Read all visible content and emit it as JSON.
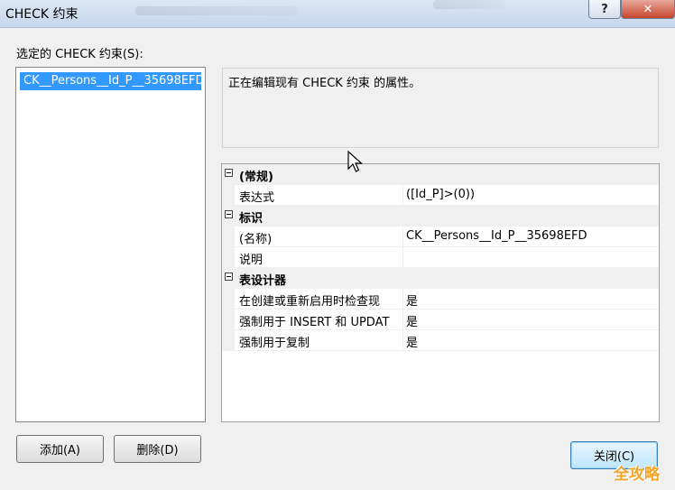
{
  "window": {
    "title": "CHECK 约束",
    "help_label": "?",
    "close_label": "✕"
  },
  "list": {
    "label": "选定的 CHECK 约束(S):",
    "items": [
      "CK__Persons__Id_P__35698EFD"
    ]
  },
  "description": "正在编辑现有 CHECK 约束 的属性。",
  "properties": [
    {
      "category": "(常规)",
      "rows": [
        {
          "name": "表达式",
          "value": "([Id_P]>(0))"
        }
      ]
    },
    {
      "category": "标识",
      "rows": [
        {
          "name": "(名称)",
          "value": "CK__Persons__Id_P__35698EFD"
        },
        {
          "name": "说明",
          "value": ""
        }
      ]
    },
    {
      "category": "表设计器",
      "rows": [
        {
          "name": "在创建或重新启用时检查现",
          "value": "是"
        },
        {
          "name": "强制用于 INSERT 和 UPDAT",
          "value": "是"
        },
        {
          "name": "强制用于复制",
          "value": "是"
        }
      ]
    }
  ],
  "buttons": {
    "add": "添加(A)",
    "delete": "删除(D)",
    "close": "关闭(C)"
  },
  "watermark": "全攻略",
  "colors": {
    "selection": "#3399ff",
    "close_button": "#c5452b",
    "watermark": "#f3a52a"
  }
}
